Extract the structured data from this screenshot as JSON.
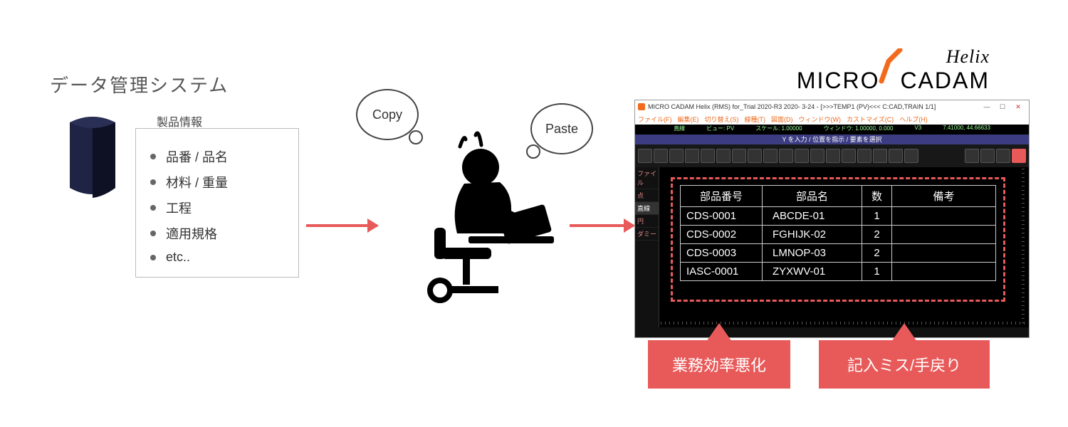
{
  "left": {
    "title": "データ管理システム",
    "product_info_title": "製品情報",
    "items": [
      "品番 / 品名",
      "材料 / 重量",
      "工程",
      "適用規格",
      "etc.."
    ]
  },
  "bubbles": {
    "copy": "Copy",
    "paste": "Paste"
  },
  "logo": {
    "helix": "Helix",
    "micro": "MICRO",
    "cadam": "CADAM"
  },
  "cad": {
    "title": "MICRO CADAM Helix (RMS) for_Trial 2020-R3 2020- 3-24 - [>>>TEMP1          (PV)<<<  C:CAD,TRAIN    1/1]",
    "menus": [
      "ファイル(F)",
      "編集(E)",
      "切り替え(S)",
      "線種(T)",
      "図面(D)",
      "ウィンドウ(W)",
      "カストマイズ(C)",
      "ヘルプ(H)"
    ],
    "status_line1": [
      "直線",
      "ビュー: PV",
      "スケール: 1.00000",
      "ウィンドウ: 1.00000, 0.000",
      "V3",
      "7.41000,   44.66633"
    ],
    "status_line2": "Y を入力 / 位置を指示 / 要素を選択",
    "sidebar": [
      "ファイル",
      "点",
      "直線",
      "円",
      "ダミー"
    ],
    "table": {
      "headers": [
        "部品番号",
        "部品名",
        "数",
        "備考"
      ],
      "rows": [
        [
          "CDS-0001",
          "ABCDE-01",
          "1",
          ""
        ],
        [
          "CDS-0002",
          "FGHIJK-02",
          "2",
          ""
        ],
        [
          "CDS-0003",
          "LMNOP-03",
          "2",
          ""
        ],
        [
          "IASC-0001",
          "ZYXWV-01",
          "1",
          ""
        ]
      ]
    }
  },
  "callouts": {
    "c1": "業務効率悪化",
    "c2": "記入ミス/手戻り"
  }
}
